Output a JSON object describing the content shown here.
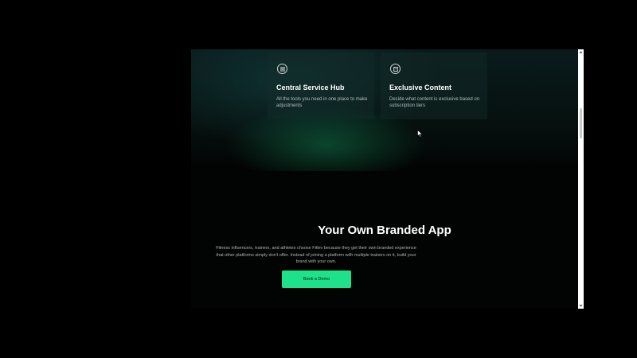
{
  "features": [
    {
      "icon": "list-icon",
      "title": "Central Service Hub",
      "description": "All the tools you need in one place to make adjustments"
    },
    {
      "icon": "document-icon",
      "title": "Exclusive Content",
      "description": "Decide what content is exclusive based on subscription tiers"
    }
  ],
  "branded_app": {
    "title": "Your Own Branded App",
    "description": "Fitness influencers, trainers, and athletes choose Fitlev because they get their own branded experience that other platforms simply don't offer. Instead of joining a platform with multiple trainers on it, build your brand with your own.",
    "cta_label": "Book a Demo"
  },
  "colors": {
    "accent": "#1de28a",
    "background": "#000000",
    "card": "#142d2a"
  }
}
